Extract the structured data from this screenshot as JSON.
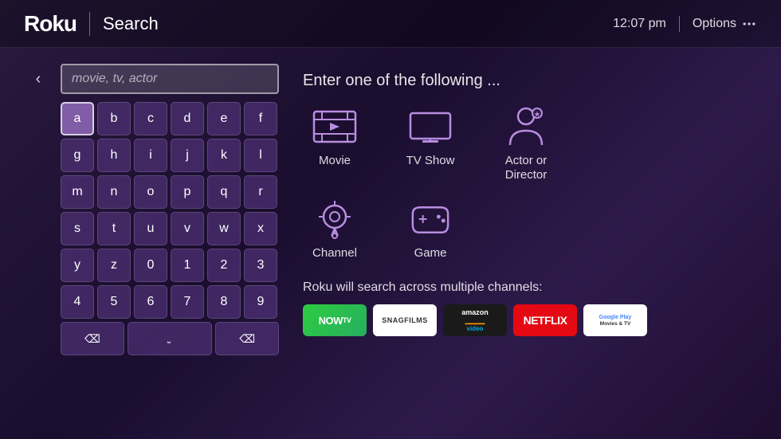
{
  "header": {
    "logo": "Roku",
    "title": "Search",
    "time": "12:07 pm",
    "options_label": "Options"
  },
  "search": {
    "placeholder": "movie, tv, actor"
  },
  "keyboard": {
    "rows": [
      [
        "a",
        "b",
        "c",
        "d",
        "e",
        "f"
      ],
      [
        "g",
        "h",
        "i",
        "j",
        "k",
        "l"
      ],
      [
        "m",
        "n",
        "o",
        "p",
        "q",
        "r"
      ],
      [
        "s",
        "t",
        "u",
        "v",
        "w",
        "x"
      ],
      [
        "y",
        "z",
        "0",
        "1",
        "2",
        "3"
      ],
      [
        "4",
        "5",
        "6",
        "7",
        "8",
        "9"
      ]
    ],
    "special": {
      "delete": "⌫",
      "space": "___",
      "backspace": "⌫"
    }
  },
  "right": {
    "prompt": "Enter one of the following ...",
    "categories": [
      {
        "label": "Movie",
        "icon": "film-icon"
      },
      {
        "label": "TV Show",
        "icon": "tv-icon"
      },
      {
        "label": "Actor or\nDirector",
        "icon": "person-icon"
      },
      {
        "label": "Channel",
        "icon": "channel-icon"
      },
      {
        "label": "Game",
        "icon": "game-icon"
      }
    ],
    "channels_label": "Roku will search across multiple channels:",
    "channels": [
      {
        "name": "NOW TV",
        "type": "nowtv"
      },
      {
        "name": "SnagFilms",
        "type": "snagfilms"
      },
      {
        "name": "Amazon Video",
        "type": "amazon"
      },
      {
        "name": "Netflix",
        "type": "netflix"
      },
      {
        "name": "Google Play",
        "type": "googleplay"
      }
    ]
  }
}
